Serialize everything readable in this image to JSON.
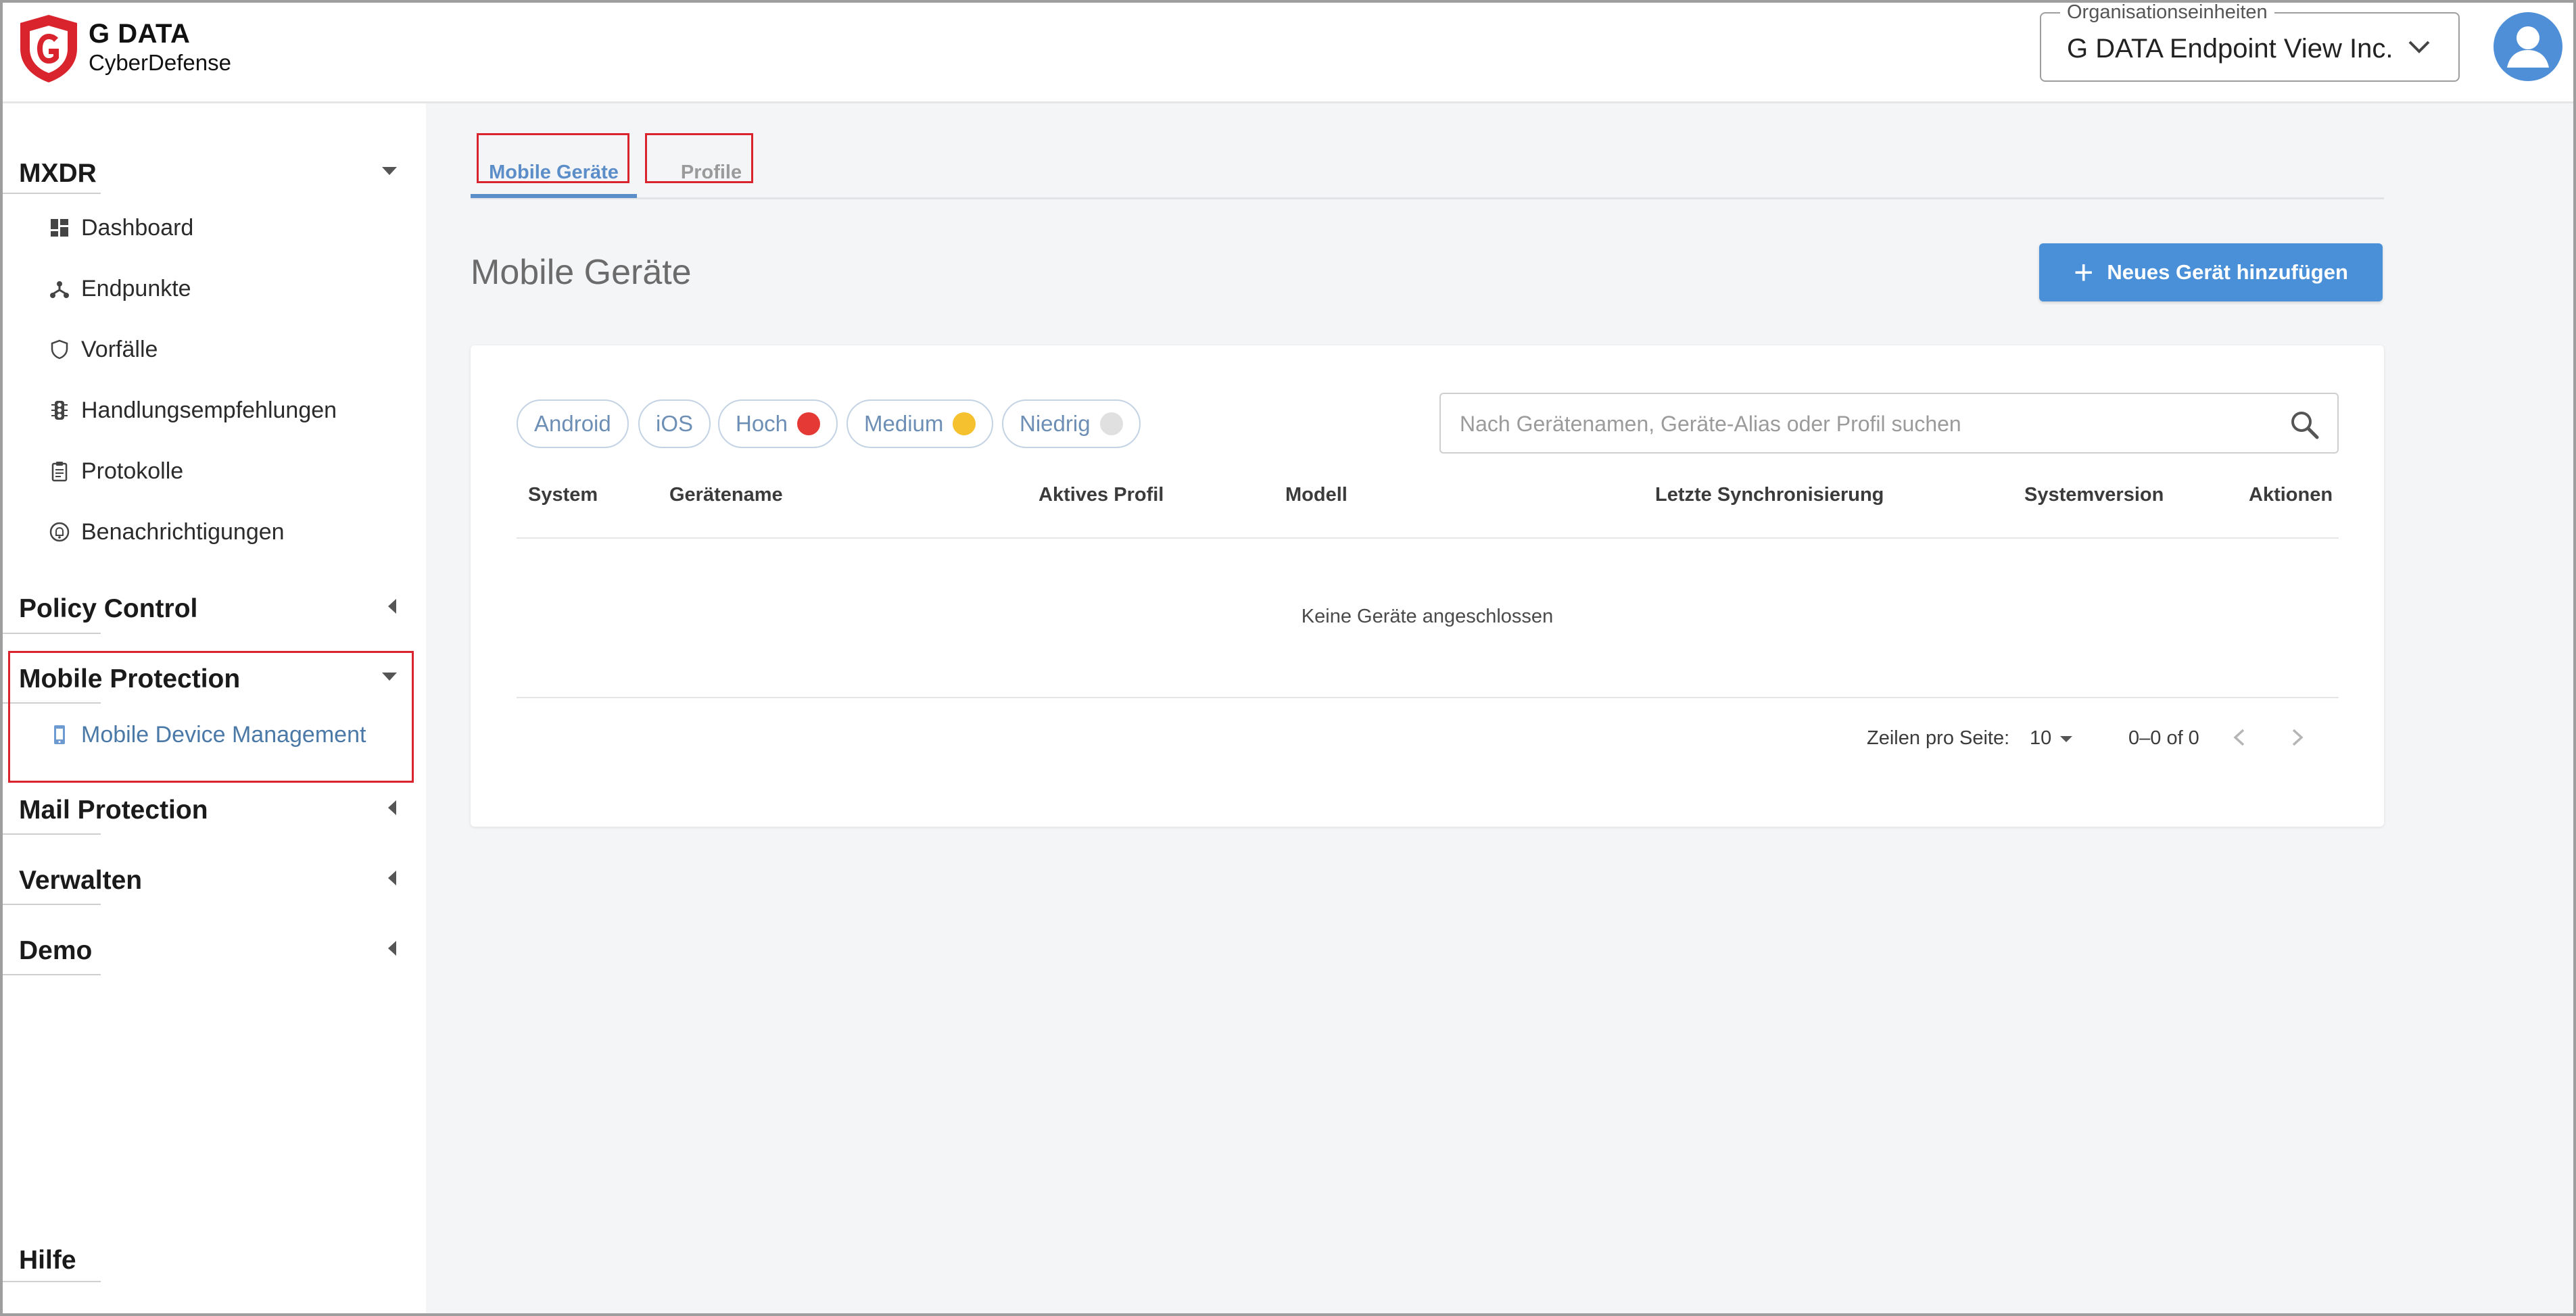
{
  "header": {
    "brand_name": "G DATA",
    "brand_sub": "CyberDefense",
    "org_label": "Organisationseinheiten",
    "org_value": "G DATA Endpoint View Inc."
  },
  "sidebar": {
    "sections": {
      "mxdr": "MXDR",
      "policy_control": "Policy Control",
      "mobile_protection": "Mobile Protection",
      "mail_protection": "Mail Protection",
      "verwalten": "Verwalten",
      "demo": "Demo",
      "hilfe": "Hilfe"
    },
    "mxdr_items": [
      {
        "label": "Dashboard",
        "icon": "dashboard-icon"
      },
      {
        "label": "Endpunkte",
        "icon": "endpoints-icon"
      },
      {
        "label": "Vorfälle",
        "icon": "shield-icon"
      },
      {
        "label": "Handlungsempfehlungen",
        "icon": "traffic-light-icon"
      },
      {
        "label": "Protokolle",
        "icon": "clipboard-icon"
      },
      {
        "label": "Benachrichtigungen",
        "icon": "bell-icon"
      }
    ],
    "mobile_items": [
      {
        "label": "Mobile Device Management",
        "icon": "mobile-phone-icon"
      }
    ]
  },
  "tabs": [
    {
      "label": "Mobile Geräte",
      "active": true
    },
    {
      "label": "Profile",
      "active": false
    }
  ],
  "page_title": "Mobile Geräte",
  "add_button": {
    "label": "Neues Gerät hinzufügen"
  },
  "filters": [
    {
      "label": "Android"
    },
    {
      "label": "iOS"
    },
    {
      "label": "Hoch",
      "dot_color": "#e53935"
    },
    {
      "label": "Medium",
      "dot_color": "#f5c12e"
    },
    {
      "label": "Niedrig",
      "dot_color": "#e0e0e0"
    }
  ],
  "search": {
    "placeholder": "Nach Gerätenamen, Geräte-Alias oder Profil suchen"
  },
  "table": {
    "columns": [
      "System",
      "Gerätename",
      "Aktives Profil",
      "Modell",
      "Letzte Synchronisierung",
      "Systemversion",
      "Aktionen"
    ],
    "empty_message": "Keine Geräte angeschlossen"
  },
  "pagination": {
    "rows_label": "Zeilen pro Seite:",
    "rows_value": "10",
    "range": "0–0 of 0"
  },
  "colors": {
    "accent": "#4a90d9",
    "highlight": "#d9232d",
    "brand_red": "#d9232d"
  }
}
